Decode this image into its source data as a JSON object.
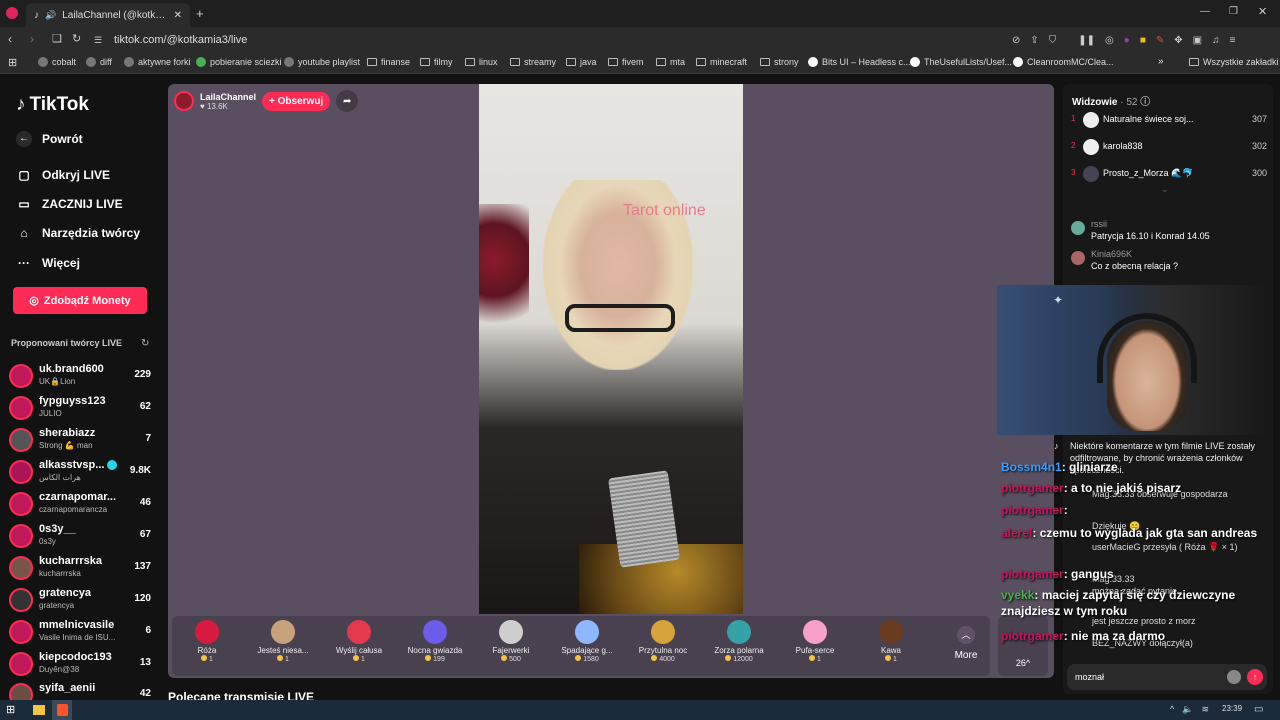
{
  "browser": {
    "tab_title": "LailaChannel (@kotkamia3) p",
    "new_tab_symbol": "+",
    "url": "tiktok.com/@kotkamia3/live",
    "bookmarks": [
      "cobalt",
      "diff",
      "aktywne forki",
      "pobieranie sciezki",
      "youtube playlist",
      "finanse",
      "filmy",
      "linux",
      "streamy",
      "java",
      "fivem",
      "mta",
      "minecraft",
      "strony",
      "Bits UI – Headless c...",
      "TheUsefulLists/Usef...",
      "CleanroomMC/Clea..."
    ],
    "all_bookmarks": "Wszystkie zakładki"
  },
  "nav": {
    "logo": "TikTok",
    "back": "Powrót",
    "items": [
      "Odkryj LIVE",
      "ZACZNIJ LIVE",
      "Narzędzia twórcy",
      "Więcej"
    ],
    "coins_button": "Zdobądź Monety",
    "suggested_title": "Proponowani twórcy LIVE",
    "creators": [
      {
        "name": "uk.brand600",
        "sub": "UK🔒Lion",
        "count": "229"
      },
      {
        "name": "fypguyss123",
        "sub": "JULIO",
        "count": "62"
      },
      {
        "name": "sherabiazz",
        "sub": "Strong 💪 man",
        "count": "7"
      },
      {
        "name": "alkasstvsp...",
        "sub": "هرات الكاس",
        "count": "9.8K"
      },
      {
        "name": "czarnapomar...",
        "sub": "czarnapomarancza",
        "count": "46"
      },
      {
        "name": "0s3y__",
        "sub": "0s3y",
        "count": "67"
      },
      {
        "name": "kucharrrska",
        "sub": "kucharrrska",
        "count": "137"
      },
      {
        "name": "gratencya",
        "sub": "gratencya",
        "count": "120"
      },
      {
        "name": "mmelnicvasile",
        "sub": "Vasile Inima de ISU...",
        "count": "6"
      },
      {
        "name": "kiepcodoc193",
        "sub": "Duyên@38",
        "count": "13"
      },
      {
        "name": "syifa_aenii",
        "sub": "",
        "count": "42"
      }
    ]
  },
  "stream": {
    "host_name": "LailaChannel",
    "host_likes": "13.6K",
    "follow_label": "+ Obserwuj",
    "video_caption": "Tarot online",
    "gifts": [
      {
        "name": "Róża",
        "price": "1",
        "color": "#d81b3c"
      },
      {
        "name": "Jesteś niesa...",
        "price": "1",
        "color": "#c8a27a"
      },
      {
        "name": "Wyślij całusa",
        "price": "1",
        "color": "#e5394d"
      },
      {
        "name": "Nocna gwiazda",
        "price": "199",
        "color": "#6c5ce7"
      },
      {
        "name": "Fajerwerki",
        "price": "500",
        "color": "#cfcfcf"
      },
      {
        "name": "Spadające g...",
        "price": "1580",
        "color": "#8fb7ff"
      },
      {
        "name": "Przytulna noc",
        "price": "4000",
        "color": "#d6a23a"
      },
      {
        "name": "Zorza polarna",
        "price": "12000",
        "color": "#36a2a8"
      },
      {
        "name": "Pufa-serce",
        "price": "1",
        "color": "#f7a1c9"
      },
      {
        "name": "Kawa",
        "price": "1",
        "color": "#6b3b1f"
      }
    ],
    "more_label": "More",
    "count_label": "26",
    "recommended_title": "Polecane transmisje LIVE"
  },
  "chat": {
    "viewers_title": "Widzowie",
    "viewers_count": "· 52",
    "top_viewers": [
      {
        "rank": "1",
        "name": "Naturalne świece soj...",
        "score": "307"
      },
      {
        "rank": "2",
        "name": "karola838",
        "score": "302"
      },
      {
        "rank": "3",
        "name": "Prosto_z_Morza 🌊🐬",
        "score": "300"
      }
    ],
    "comments": [
      {
        "user": "rssii",
        "text": "Patrycja 16.10 i Konrad 14.05"
      },
      {
        "user": "Kinia696K",
        "text": "Co z obecną relacja ?"
      }
    ],
    "notice": "Niektóre komentarze w tym filmie LIVE zostały odfiltrowane, by chronić wrażenia członków społeczności.",
    "ghost_lines": [
      "Mag.33.33  obserwuje gospodarza",
      "Dziękuję 😊",
      "userMacieG przesyła ( Róża 🌹 × 1)",
      "Mag.33.33",
      "można zadać pytanie",
      "jest jeszcze prosto z morz",
      "BEZ_NAZWY  dołączył(a)"
    ],
    "input_value": "moznał"
  },
  "overlay_chat": [
    {
      "user": "Bossm4n1",
      "text": "gliniarze"
    },
    {
      "user": "piotrgamer",
      "text": "a to nie jakiś pisarz"
    },
    {
      "user": "piotrgamer",
      "text": ""
    },
    {
      "user": "alerel",
      "text": "czemu to wyglada jak gta san andreas"
    },
    {
      "user": "piotrgamer",
      "text": "gangus"
    },
    {
      "user": "vyekk",
      "text": "maciej zapytaj się czy dziewczyne znajdziesz w tym roku"
    },
    {
      "user": "piotrgamer",
      "text": "nie ma za darmo"
    }
  ],
  "taskbar": {
    "time": "23:39"
  }
}
